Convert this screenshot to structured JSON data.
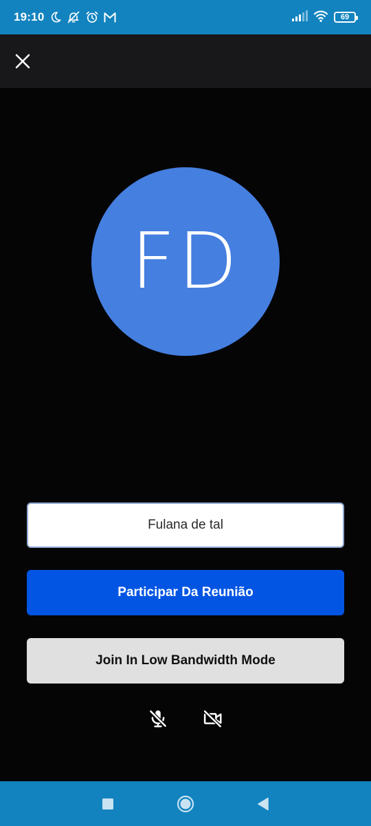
{
  "status_bar": {
    "time": "19:10",
    "left_icons": [
      "moon-icon",
      "notifications-off-icon",
      "alarm-icon",
      "gmail-icon"
    ],
    "right_icons": [
      "signal-icon",
      "wifi-icon",
      "battery-icon"
    ],
    "battery_level": "69"
  },
  "toolbar": {
    "close_icon": "close-icon"
  },
  "avatar": {
    "initials": "FD",
    "color": "#457fe0"
  },
  "form": {
    "name_value": "Fulana de tal",
    "join_label": "Participar Da Reunião",
    "low_bandwidth_label": "Join In Low Bandwidth Mode"
  },
  "media_controls": {
    "mic_icon": "mic-off-icon",
    "camera_icon": "video-off-icon"
  },
  "nav_bar": {
    "icons": [
      "recents-icon",
      "home-icon",
      "back-icon"
    ]
  },
  "colors": {
    "status_bar": "#1283bf",
    "toolbar": "#18181a",
    "background": "#050506",
    "primary_button": "#0255e3",
    "secondary_button": "#e0e0e0"
  }
}
